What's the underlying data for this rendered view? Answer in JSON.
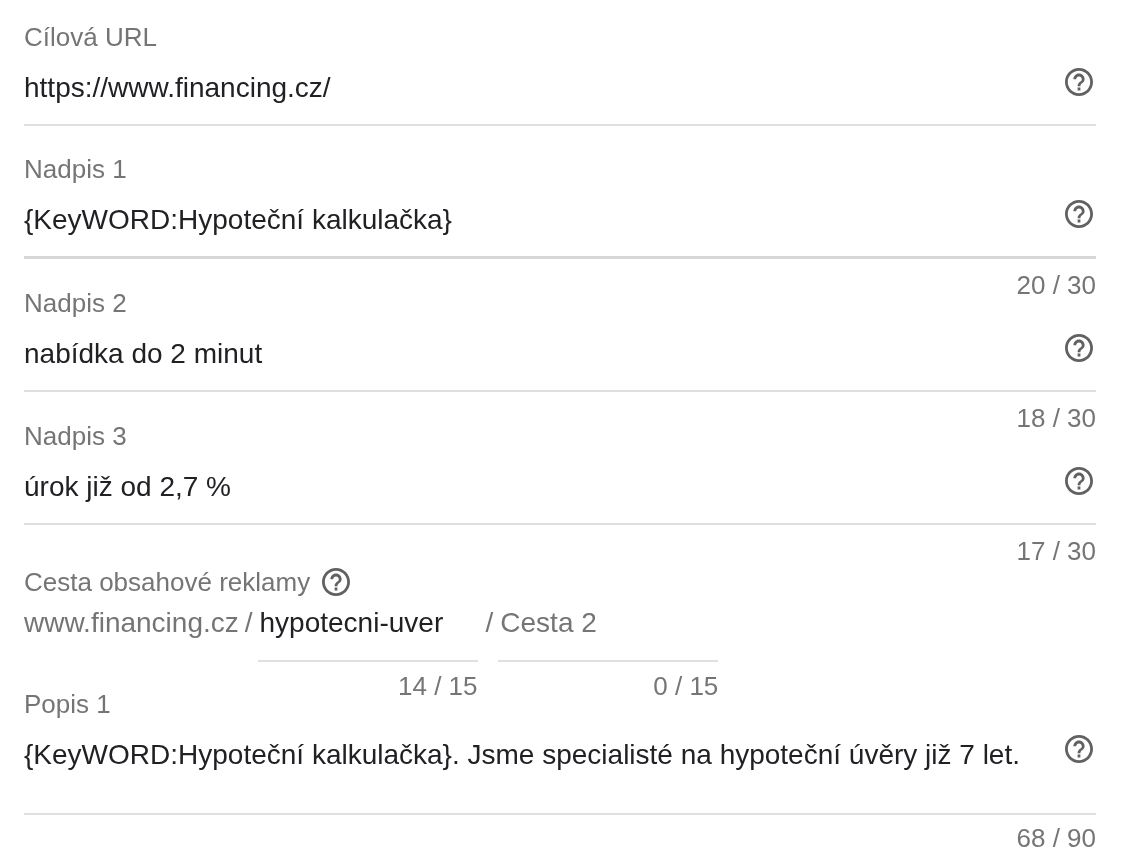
{
  "fields": [
    {
      "kind": "text",
      "label": "Cílová URL",
      "value": "https://www.financing.cz/",
      "hovered": false
    },
    {
      "kind": "text",
      "label": "Nadpis 1",
      "value": "{KeyWORD:Hypoteční kalkulačka}",
      "hovered": true,
      "counter": "20 / 30"
    },
    {
      "kind": "text",
      "label": "Nadpis 2",
      "value": "nabídka do 2 minut",
      "hovered": false,
      "counter": "18 / 30"
    },
    {
      "kind": "text",
      "label": "Nadpis 3",
      "value": "úrok již od 2,7 %",
      "hovered": false,
      "counter": "17 / 30"
    },
    {
      "kind": "path",
      "label": "Cesta obsahové reklamy",
      "domain": "www.financing.cz",
      "paths": [
        {
          "separator": "/",
          "value": "hypotecni-uver",
          "counter": "14 / 15"
        },
        {
          "separator": "/",
          "placeholder": "Cesta 2",
          "counter": "0 / 15"
        }
      ]
    },
    {
      "kind": "textarea",
      "label": "Popis 1",
      "value": "{KeyWORD:Hypoteční kalkulačka}. Jsme specialisté na hypoteční úvěry již 7 let.",
      "hovered": false,
      "counter": "68 / 90"
    }
  ]
}
